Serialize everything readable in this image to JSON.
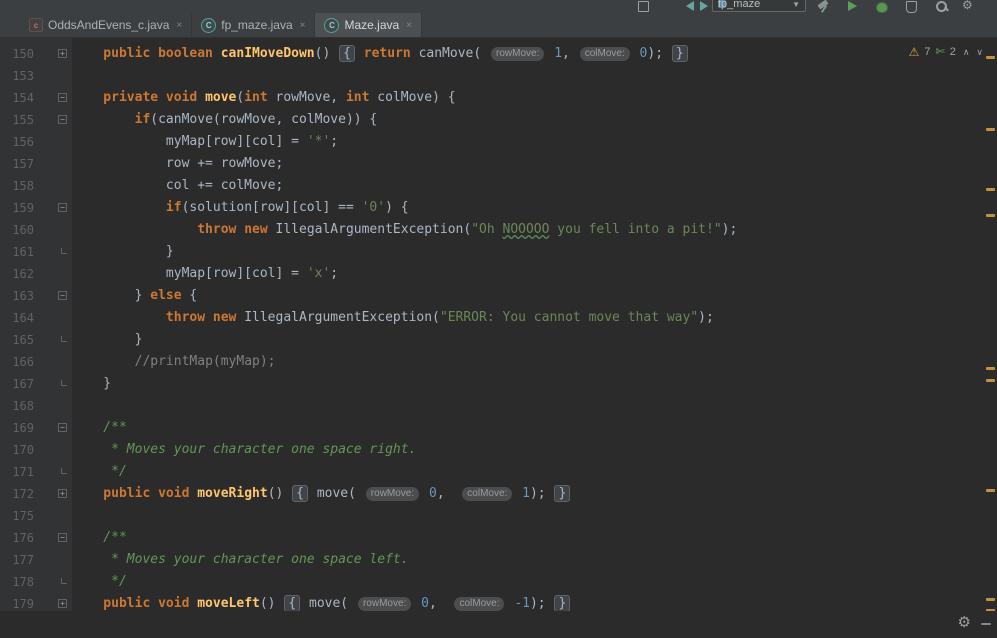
{
  "toolbar": {
    "run_config": "fp_maze",
    "icons": [
      "component-icon",
      "back-icon",
      "forward-icon",
      "build-hammer-icon",
      "run-icon",
      "debug-icon",
      "coverage-icon",
      "search-icon",
      "settings-icon"
    ]
  },
  "tabs": [
    {
      "label": "OddsAndEvens_c.java",
      "icon": "c-file-icon",
      "close": "×",
      "active": false
    },
    {
      "label": "fp_maze.java",
      "icon": "class-icon",
      "icon_letter": "C",
      "close": "×",
      "active": false
    },
    {
      "label": "Maze.java",
      "icon": "class-icon",
      "icon_letter": "C",
      "close": "×",
      "active": true
    }
  ],
  "inspections": {
    "warning_count": "7",
    "typo_count": "2"
  },
  "editor": {
    "bg": "#2b2b2b",
    "gutter_bg": "#313335",
    "keyword_color": "#cc7832",
    "string_color": "#6a8759",
    "lines": [
      {
        "n": "150",
        "g": "plus",
        "t": [
          [
            "kw",
            "    public boolean "
          ],
          [
            "fn",
            "canIMoveDown"
          ],
          [
            "pl",
            "() "
          ],
          [
            "fold",
            "{"
          ],
          [
            "pl",
            " "
          ],
          [
            "kw",
            "return"
          ],
          [
            "pl",
            " canMove( "
          ],
          [
            "hint",
            "rowMove:"
          ],
          [
            "pl",
            " "
          ],
          [
            "num",
            "1"
          ],
          [
            "pl",
            ", "
          ],
          [
            "hint",
            "colMove:"
          ],
          [
            "pl",
            " "
          ],
          [
            "num",
            "0"
          ],
          [
            "pl",
            "); "
          ],
          [
            "fold",
            "}"
          ]
        ]
      },
      {
        "n": "153",
        "g": "",
        "t": []
      },
      {
        "n": "154",
        "g": "minus",
        "t": [
          [
            "kw",
            "    private void "
          ],
          [
            "fn",
            "move"
          ],
          [
            "pl",
            "("
          ],
          [
            "kw",
            "int"
          ],
          [
            "pl",
            " rowMove, "
          ],
          [
            "kw",
            "int"
          ],
          [
            "pl",
            " colMove) {"
          ]
        ]
      },
      {
        "n": "155",
        "g": "minus",
        "t": [
          [
            "pl",
            "        "
          ],
          [
            "kw",
            "if"
          ],
          [
            "pl",
            "(canMove(rowMove, colMove)) {"
          ]
        ]
      },
      {
        "n": "156",
        "g": "",
        "t": [
          [
            "pl",
            "            myMap[row][col] = "
          ],
          [
            "str",
            "'*'"
          ],
          [
            "pl",
            ";"
          ]
        ]
      },
      {
        "n": "157",
        "g": "",
        "t": [
          [
            "pl",
            "            row += rowMove;"
          ]
        ]
      },
      {
        "n": "158",
        "g": "",
        "t": [
          [
            "pl",
            "            col += colMove;"
          ]
        ]
      },
      {
        "n": "159",
        "g": "minus",
        "t": [
          [
            "pl",
            "            "
          ],
          [
            "kw",
            "if"
          ],
          [
            "pl",
            "(solution[row][col] == "
          ],
          [
            "str",
            "'0'"
          ],
          [
            "pl",
            ") {"
          ]
        ]
      },
      {
        "n": "160",
        "g": "",
        "t": [
          [
            "pl",
            "                "
          ],
          [
            "kw",
            "throw new "
          ],
          [
            "pl",
            "IllegalArgumentException("
          ],
          [
            "str",
            "\"Oh "
          ],
          [
            "typo",
            "NOOOOO"
          ],
          [
            "str",
            " you fell into a pit!\""
          ],
          [
            "pl",
            ");"
          ]
        ]
      },
      {
        "n": "161",
        "g": "end",
        "t": [
          [
            "pl",
            "            }"
          ]
        ]
      },
      {
        "n": "162",
        "g": "",
        "t": [
          [
            "pl",
            "            myMap[row][col] = "
          ],
          [
            "str",
            "'x'"
          ],
          [
            "pl",
            ";"
          ]
        ]
      },
      {
        "n": "163",
        "g": "minus",
        "t": [
          [
            "pl",
            "        } "
          ],
          [
            "kw",
            "else"
          ],
          [
            "pl",
            " {"
          ]
        ]
      },
      {
        "n": "164",
        "g": "",
        "t": [
          [
            "pl",
            "            "
          ],
          [
            "kw",
            "throw new "
          ],
          [
            "pl",
            "IllegalArgumentException("
          ],
          [
            "str",
            "\"ERROR: You cannot move that way\""
          ],
          [
            "pl",
            ");"
          ]
        ]
      },
      {
        "n": "165",
        "g": "end",
        "t": [
          [
            "pl",
            "        }"
          ]
        ]
      },
      {
        "n": "166",
        "g": "",
        "t": [
          [
            "pl",
            "        "
          ],
          [
            "cmt",
            "//printMap(myMap);"
          ]
        ]
      },
      {
        "n": "167",
        "g": "end",
        "t": [
          [
            "pl",
            "    }"
          ]
        ]
      },
      {
        "n": "168",
        "g": "",
        "t": []
      },
      {
        "n": "169",
        "g": "minus",
        "t": [
          [
            "doc",
            "    /**"
          ]
        ]
      },
      {
        "n": "170",
        "g": "",
        "t": [
          [
            "doc",
            "     * Moves your character one space right."
          ]
        ]
      },
      {
        "n": "171",
        "g": "end",
        "t": [
          [
            "doc",
            "     */"
          ]
        ]
      },
      {
        "n": "172",
        "g": "plus",
        "t": [
          [
            "kw",
            "    public void "
          ],
          [
            "fn",
            "moveRight"
          ],
          [
            "pl",
            "() "
          ],
          [
            "fold",
            "{"
          ],
          [
            "pl",
            " move( "
          ],
          [
            "hint",
            "rowMove:"
          ],
          [
            "pl",
            " "
          ],
          [
            "num",
            "0"
          ],
          [
            "pl",
            ",  "
          ],
          [
            "hint",
            "colMove:"
          ],
          [
            "pl",
            " "
          ],
          [
            "num",
            "1"
          ],
          [
            "pl",
            "); "
          ],
          [
            "fold",
            "}"
          ]
        ]
      },
      {
        "n": "175",
        "g": "",
        "t": []
      },
      {
        "n": "176",
        "g": "minus",
        "t": [
          [
            "doc",
            "    /**"
          ]
        ]
      },
      {
        "n": "177",
        "g": "",
        "t": [
          [
            "doc",
            "     * Moves your character one space left."
          ]
        ]
      },
      {
        "n": "178",
        "g": "end",
        "t": [
          [
            "doc",
            "     */"
          ]
        ]
      },
      {
        "n": "179",
        "g": "plus",
        "t": [
          [
            "kw",
            "    public void "
          ],
          [
            "fn",
            "moveLeft"
          ],
          [
            "pl",
            "() "
          ],
          [
            "fold",
            "{"
          ],
          [
            "pl",
            " move( "
          ],
          [
            "hint",
            "rowMove:"
          ],
          [
            "pl",
            " "
          ],
          [
            "num",
            "0"
          ],
          [
            "pl",
            ",  "
          ],
          [
            "hint",
            "colMove:"
          ],
          [
            "pl",
            " "
          ],
          [
            "num",
            "-1"
          ],
          [
            "pl",
            "); "
          ],
          [
            "fold",
            "}"
          ]
        ]
      }
    ],
    "scroll_marks": [
      18,
      90,
      150,
      176,
      329,
      341,
      451,
      560,
      571
    ]
  },
  "bottombar": {
    "icons": [
      "gear-icon",
      "collapse-dash-icon"
    ]
  }
}
